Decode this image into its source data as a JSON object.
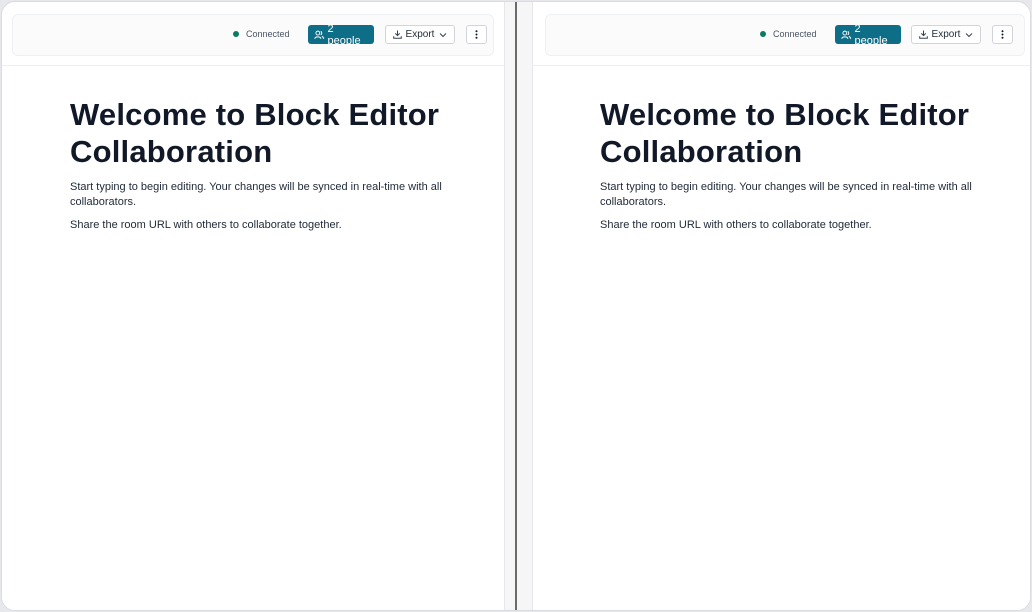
{
  "panes": [
    {
      "status": "Connected",
      "people_label": "2 people",
      "export_label": "Export",
      "title": "Welcome to Block Editor Collaboration",
      "paragraphs": [
        "Start typing to begin editing. Your changes will be synced in real-time with all collaborators.",
        "Share the room URL with others to collaborate together."
      ]
    },
    {
      "status": "Connected",
      "people_label": "2 people",
      "export_label": "Export",
      "title": "Welcome to Block Editor Collaboration",
      "paragraphs": [
        "Start typing to begin editing. Your changes will be synced in real-time with all collaborators.",
        "Share the room URL with others to collaborate together."
      ]
    }
  ],
  "colors": {
    "accent": "#0e6e87",
    "connected": "#0e7a61"
  },
  "icons": {
    "people": "users-icon",
    "export": "download-icon",
    "dropdown": "chevron-down-icon",
    "more": "more-vertical-icon"
  }
}
